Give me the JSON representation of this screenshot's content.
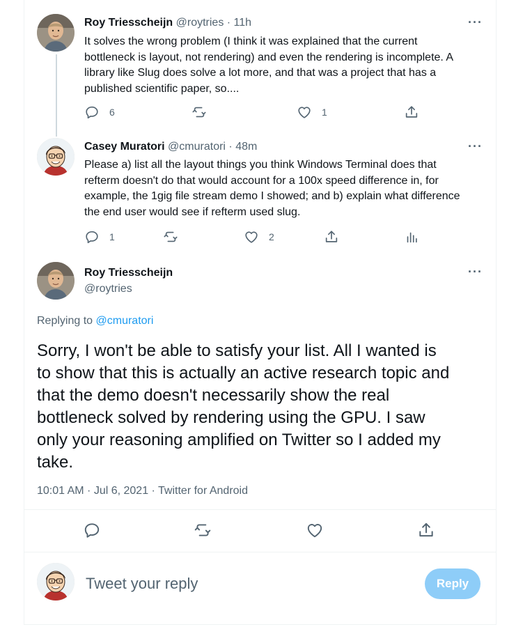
{
  "tweets": [
    {
      "name": "Roy Triesscheijn",
      "handle": "@roytries",
      "time": "· 11h",
      "text": "It solves the wrong problem (I think it was explained that the current\nbottleneck is layout, not rendering) and even the rendering is incomplete. A\nlibrary like Slug does solve a lot more, and that was a project that has a\npublished scientific paper, so....",
      "replies": "6",
      "retweets": "",
      "likes": "1",
      "avatar_icon": "profile-photo"
    },
    {
      "name": "Casey Muratori",
      "handle": "@cmuratori",
      "time": "· 48m",
      "text": "Please a) list all the layout things you think Windows Terminal does that\nrefterm doesn't do that would account for a 100x speed difference in, for\nexample, the 1gig file stream demo I showed; and b) explain what difference\nthe end user would see if refterm used slug.",
      "replies": "1",
      "retweets": "",
      "likes": "2",
      "avatar_icon": "cartoon-avatar"
    }
  ],
  "main_tweet": {
    "name": "Roy Triesscheijn",
    "handle": "@roytries",
    "replying_prefix": "Replying to",
    "replying_to": "@cmuratori",
    "text": "Sorry, I won't be able to satisfy your list. All I wanted is\nto show that this is actually an active research topic and\nthat the demo doesn't necessarily show the real\nbottleneck solved by rendering using the GPU. I saw\nonly your reasoning amplified on Twitter so I added my\ntake.",
    "meta": "10:01 AM · Jul 6, 2021 · Twitter for Android"
  },
  "composer": {
    "placeholder": "Tweet your reply",
    "reply_label": "Reply"
  },
  "icons": [
    "more-icon",
    "reply-icon",
    "retweet-icon",
    "like-icon",
    "share-icon",
    "analytics-icon"
  ],
  "colors": {
    "accent": "#1d9bf0",
    "reply_button_disabled": "#8ecdf8",
    "muted_text": "#536471",
    "thread_line": "#cfd9de"
  }
}
